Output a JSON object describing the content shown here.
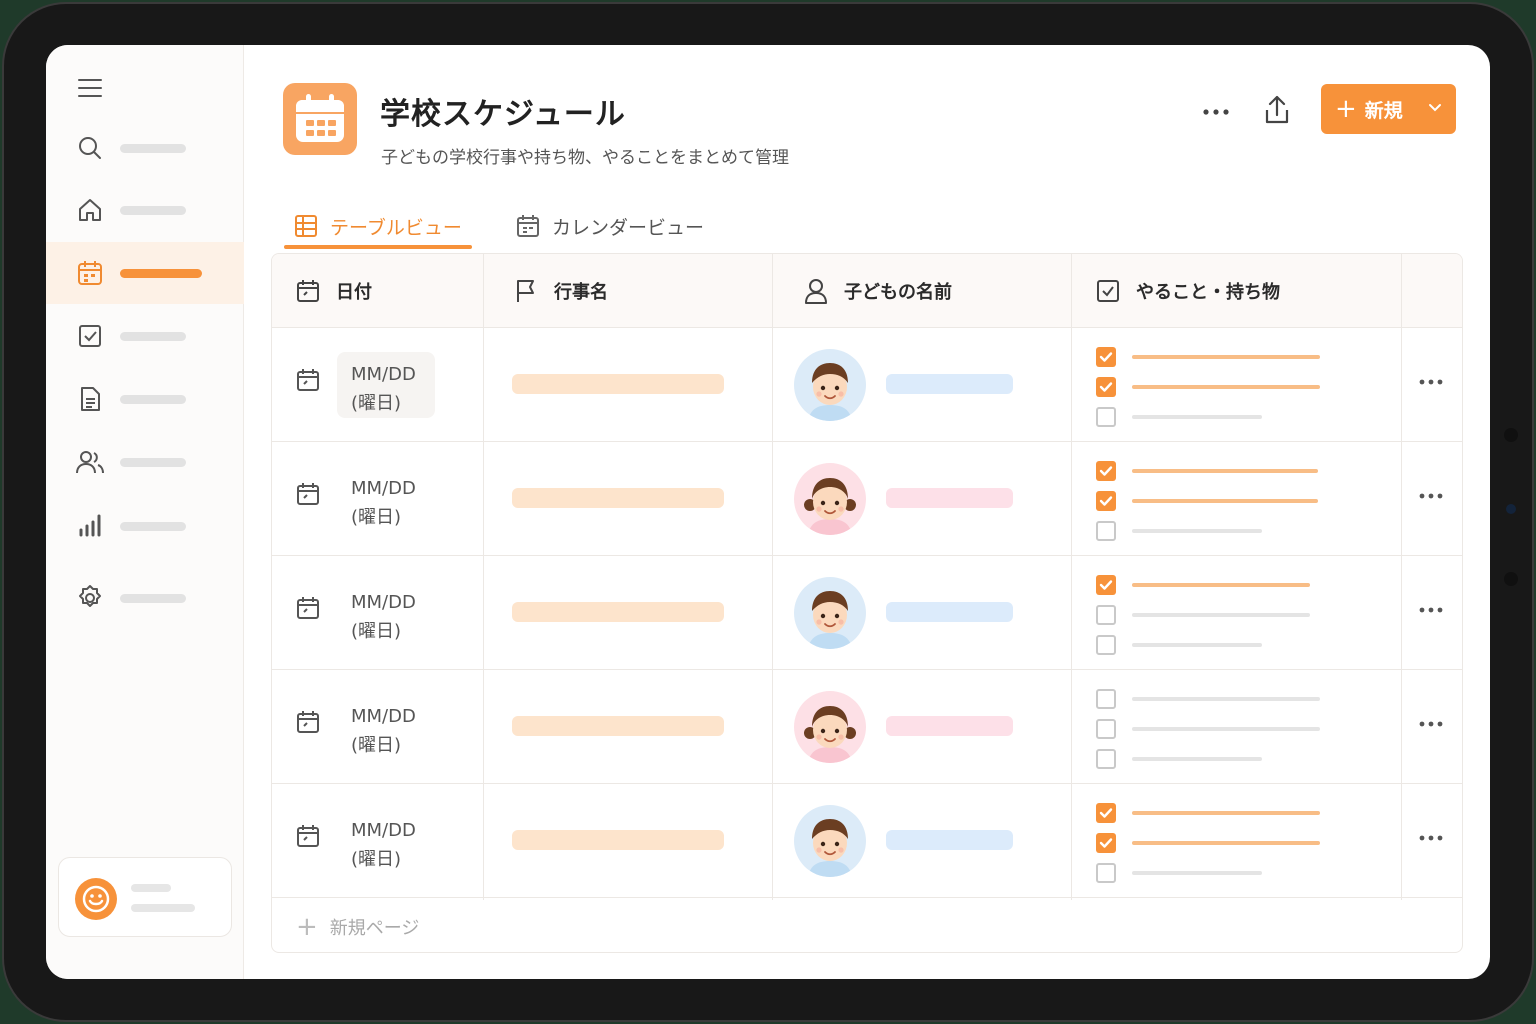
{
  "app": {
    "title": "学校スケジュール",
    "subtitle": "子どもの学校行事や持ち物、やることをまとめて管理",
    "new_button_label": "新規",
    "accent_color": "#f7923a"
  },
  "sidebar": {
    "items": [
      {
        "icon": "menu-icon"
      },
      {
        "icon": "search-icon"
      },
      {
        "icon": "home-icon"
      },
      {
        "icon": "calendar-icon",
        "active": true
      },
      {
        "icon": "checkbox-icon"
      },
      {
        "icon": "document-icon"
      },
      {
        "icon": "people-icon"
      },
      {
        "icon": "bar-chart-icon"
      },
      {
        "icon": "gear-icon"
      }
    ]
  },
  "tabs": [
    {
      "label": "テーブルビュー",
      "icon": "table-icon",
      "active": true
    },
    {
      "label": "カレンダービュー",
      "icon": "calendar-icon",
      "active": false
    }
  ],
  "table": {
    "columns": [
      {
        "label": "日付",
        "icon": "calendar-icon"
      },
      {
        "label": "行事名",
        "icon": "flag-icon"
      },
      {
        "label": "子どもの名前",
        "icon": "person-icon"
      },
      {
        "label": "やること・持ち物",
        "icon": "checkbox-icon"
      }
    ],
    "rows": [
      {
        "date": "MM/DD",
        "weekday": "(曜日)",
        "child": "boy",
        "todos": [
          true,
          true,
          false
        ]
      },
      {
        "date": "MM/DD",
        "weekday": "(曜日)",
        "child": "girl",
        "todos": [
          true,
          true,
          false
        ]
      },
      {
        "date": "MM/DD",
        "weekday": "(曜日)",
        "child": "boy",
        "todos": [
          true,
          false,
          false
        ]
      },
      {
        "date": "MM/DD",
        "weekday": "(曜日)",
        "child": "girl",
        "todos": [
          false,
          false,
          false
        ]
      },
      {
        "date": "MM/DD",
        "weekday": "(曜日)",
        "child": "boy",
        "todos": [
          true,
          true,
          false
        ]
      }
    ],
    "add_row_label": "新規ページ"
  }
}
